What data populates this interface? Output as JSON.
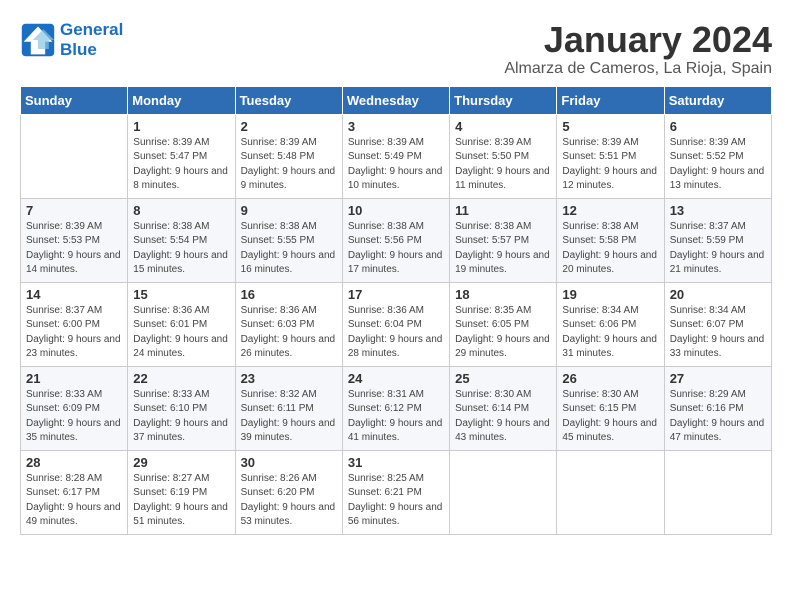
{
  "logo": {
    "line1": "General",
    "line2": "Blue"
  },
  "title": "January 2024",
  "subtitle": "Almarza de Cameros, La Rioja, Spain",
  "weekdays": [
    "Sunday",
    "Monday",
    "Tuesday",
    "Wednesday",
    "Thursday",
    "Friday",
    "Saturday"
  ],
  "weeks": [
    [
      {
        "day": "",
        "sunrise": "",
        "sunset": "",
        "daylight": ""
      },
      {
        "day": "1",
        "sunrise": "Sunrise: 8:39 AM",
        "sunset": "Sunset: 5:47 PM",
        "daylight": "Daylight: 9 hours and 8 minutes."
      },
      {
        "day": "2",
        "sunrise": "Sunrise: 8:39 AM",
        "sunset": "Sunset: 5:48 PM",
        "daylight": "Daylight: 9 hours and 9 minutes."
      },
      {
        "day": "3",
        "sunrise": "Sunrise: 8:39 AM",
        "sunset": "Sunset: 5:49 PM",
        "daylight": "Daylight: 9 hours and 10 minutes."
      },
      {
        "day": "4",
        "sunrise": "Sunrise: 8:39 AM",
        "sunset": "Sunset: 5:50 PM",
        "daylight": "Daylight: 9 hours and 11 minutes."
      },
      {
        "day": "5",
        "sunrise": "Sunrise: 8:39 AM",
        "sunset": "Sunset: 5:51 PM",
        "daylight": "Daylight: 9 hours and 12 minutes."
      },
      {
        "day": "6",
        "sunrise": "Sunrise: 8:39 AM",
        "sunset": "Sunset: 5:52 PM",
        "daylight": "Daylight: 9 hours and 13 minutes."
      }
    ],
    [
      {
        "day": "7",
        "sunrise": "Sunrise: 8:39 AM",
        "sunset": "Sunset: 5:53 PM",
        "daylight": "Daylight: 9 hours and 14 minutes."
      },
      {
        "day": "8",
        "sunrise": "Sunrise: 8:38 AM",
        "sunset": "Sunset: 5:54 PM",
        "daylight": "Daylight: 9 hours and 15 minutes."
      },
      {
        "day": "9",
        "sunrise": "Sunrise: 8:38 AM",
        "sunset": "Sunset: 5:55 PM",
        "daylight": "Daylight: 9 hours and 16 minutes."
      },
      {
        "day": "10",
        "sunrise": "Sunrise: 8:38 AM",
        "sunset": "Sunset: 5:56 PM",
        "daylight": "Daylight: 9 hours and 17 minutes."
      },
      {
        "day": "11",
        "sunrise": "Sunrise: 8:38 AM",
        "sunset": "Sunset: 5:57 PM",
        "daylight": "Daylight: 9 hours and 19 minutes."
      },
      {
        "day": "12",
        "sunrise": "Sunrise: 8:38 AM",
        "sunset": "Sunset: 5:58 PM",
        "daylight": "Daylight: 9 hours and 20 minutes."
      },
      {
        "day": "13",
        "sunrise": "Sunrise: 8:37 AM",
        "sunset": "Sunset: 5:59 PM",
        "daylight": "Daylight: 9 hours and 21 minutes."
      }
    ],
    [
      {
        "day": "14",
        "sunrise": "Sunrise: 8:37 AM",
        "sunset": "Sunset: 6:00 PM",
        "daylight": "Daylight: 9 hours and 23 minutes."
      },
      {
        "day": "15",
        "sunrise": "Sunrise: 8:36 AM",
        "sunset": "Sunset: 6:01 PM",
        "daylight": "Daylight: 9 hours and 24 minutes."
      },
      {
        "day": "16",
        "sunrise": "Sunrise: 8:36 AM",
        "sunset": "Sunset: 6:03 PM",
        "daylight": "Daylight: 9 hours and 26 minutes."
      },
      {
        "day": "17",
        "sunrise": "Sunrise: 8:36 AM",
        "sunset": "Sunset: 6:04 PM",
        "daylight": "Daylight: 9 hours and 28 minutes."
      },
      {
        "day": "18",
        "sunrise": "Sunrise: 8:35 AM",
        "sunset": "Sunset: 6:05 PM",
        "daylight": "Daylight: 9 hours and 29 minutes."
      },
      {
        "day": "19",
        "sunrise": "Sunrise: 8:34 AM",
        "sunset": "Sunset: 6:06 PM",
        "daylight": "Daylight: 9 hours and 31 minutes."
      },
      {
        "day": "20",
        "sunrise": "Sunrise: 8:34 AM",
        "sunset": "Sunset: 6:07 PM",
        "daylight": "Daylight: 9 hours and 33 minutes."
      }
    ],
    [
      {
        "day": "21",
        "sunrise": "Sunrise: 8:33 AM",
        "sunset": "Sunset: 6:09 PM",
        "daylight": "Daylight: 9 hours and 35 minutes."
      },
      {
        "day": "22",
        "sunrise": "Sunrise: 8:33 AM",
        "sunset": "Sunset: 6:10 PM",
        "daylight": "Daylight: 9 hours and 37 minutes."
      },
      {
        "day": "23",
        "sunrise": "Sunrise: 8:32 AM",
        "sunset": "Sunset: 6:11 PM",
        "daylight": "Daylight: 9 hours and 39 minutes."
      },
      {
        "day": "24",
        "sunrise": "Sunrise: 8:31 AM",
        "sunset": "Sunset: 6:12 PM",
        "daylight": "Daylight: 9 hours and 41 minutes."
      },
      {
        "day": "25",
        "sunrise": "Sunrise: 8:30 AM",
        "sunset": "Sunset: 6:14 PM",
        "daylight": "Daylight: 9 hours and 43 minutes."
      },
      {
        "day": "26",
        "sunrise": "Sunrise: 8:30 AM",
        "sunset": "Sunset: 6:15 PM",
        "daylight": "Daylight: 9 hours and 45 minutes."
      },
      {
        "day": "27",
        "sunrise": "Sunrise: 8:29 AM",
        "sunset": "Sunset: 6:16 PM",
        "daylight": "Daylight: 9 hours and 47 minutes."
      }
    ],
    [
      {
        "day": "28",
        "sunrise": "Sunrise: 8:28 AM",
        "sunset": "Sunset: 6:17 PM",
        "daylight": "Daylight: 9 hours and 49 minutes."
      },
      {
        "day": "29",
        "sunrise": "Sunrise: 8:27 AM",
        "sunset": "Sunset: 6:19 PM",
        "daylight": "Daylight: 9 hours and 51 minutes."
      },
      {
        "day": "30",
        "sunrise": "Sunrise: 8:26 AM",
        "sunset": "Sunset: 6:20 PM",
        "daylight": "Daylight: 9 hours and 53 minutes."
      },
      {
        "day": "31",
        "sunrise": "Sunrise: 8:25 AM",
        "sunset": "Sunset: 6:21 PM",
        "daylight": "Daylight: 9 hours and 56 minutes."
      },
      {
        "day": "",
        "sunrise": "",
        "sunset": "",
        "daylight": ""
      },
      {
        "day": "",
        "sunrise": "",
        "sunset": "",
        "daylight": ""
      },
      {
        "day": "",
        "sunrise": "",
        "sunset": "",
        "daylight": ""
      }
    ]
  ]
}
